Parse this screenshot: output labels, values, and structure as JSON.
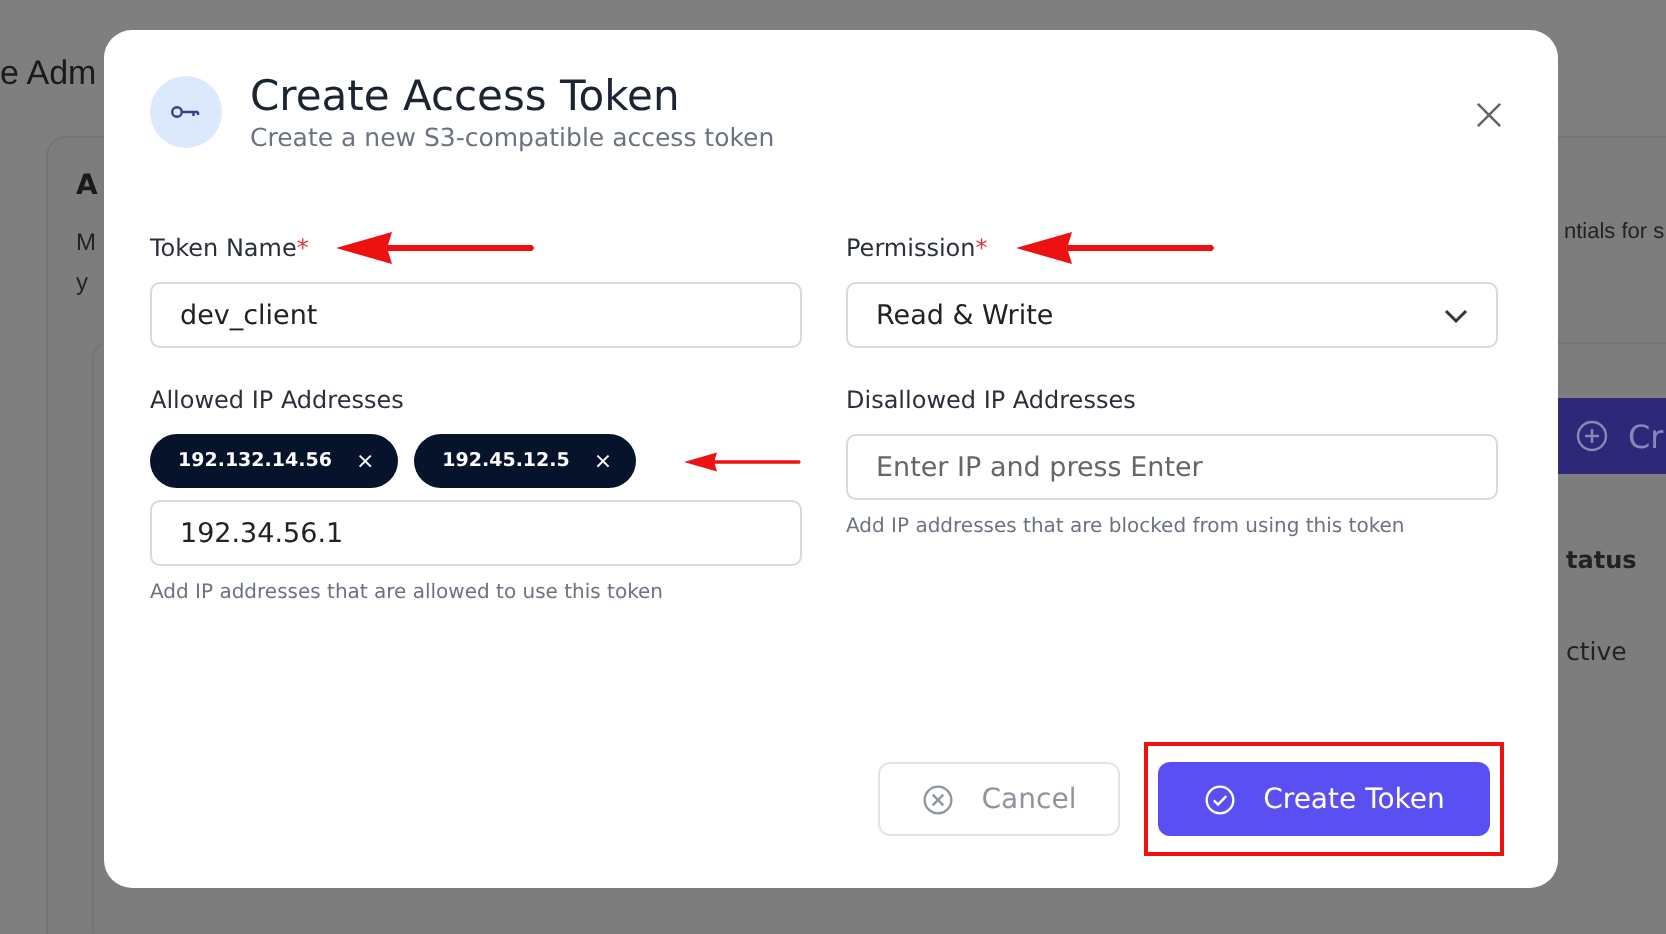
{
  "background": {
    "page_title": "e Adm",
    "card_title": "A",
    "card_lines": [
      "M",
      "y"
    ],
    "right_text": "ntials for s",
    "create_button": "Cr",
    "table_header": "tatus",
    "table_cell": "ctive"
  },
  "dialog": {
    "title": "Create Access Token",
    "subtitle": "Create a new S3-compatible access token",
    "fields": [
      {
        "kind": "text",
        "label": "Token Name",
        "required_mark": "*",
        "annotated": true,
        "value": "dev_client"
      },
      {
        "kind": "select",
        "label": "Permission",
        "required_mark": "*",
        "annotated": true,
        "value": "Read & Write"
      },
      {
        "kind": "tags",
        "label": "Allowed IP Addresses",
        "annotated": true,
        "chips": [
          {
            "text": "192.132.14.56",
            "remove": "×"
          },
          {
            "text": "192.45.12.5",
            "remove": "×"
          }
        ],
        "value": "192.34.56.1",
        "help": "Add IP addresses that are allowed to use this token"
      },
      {
        "kind": "tags",
        "label": "Disallowed IP Addresses",
        "placeholder": "Enter IP and press Enter",
        "help": "Add IP addresses that are blocked from using this token"
      }
    ],
    "buttons": [
      {
        "kind": "cancel",
        "label": "Cancel",
        "disabled": true,
        "highlighted": false
      },
      {
        "kind": "primary",
        "label": "Create Token",
        "disabled": false,
        "highlighted": true
      }
    ]
  }
}
